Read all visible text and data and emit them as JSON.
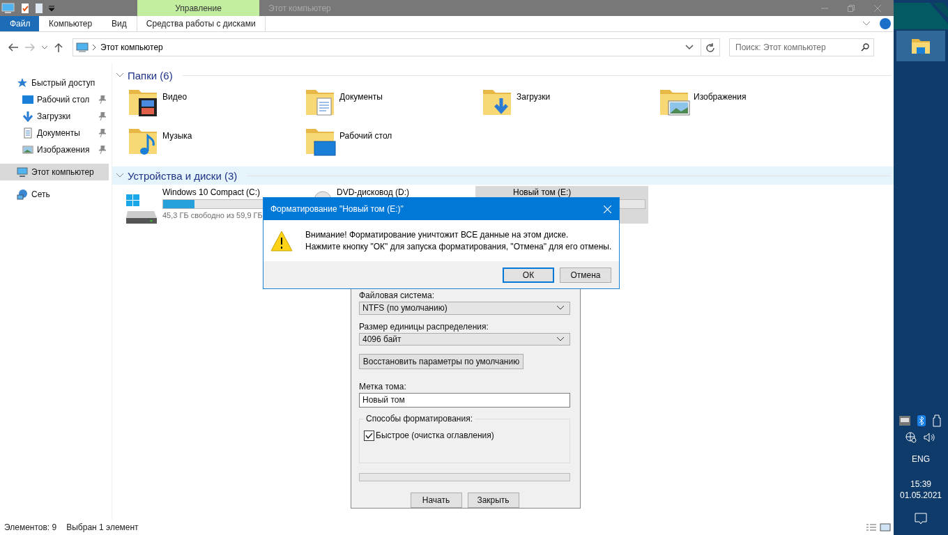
{
  "titlebar": {
    "context_tab": "Управление",
    "title": "Этот компьютер"
  },
  "ribbon_tabs": [
    {
      "label": "Файл",
      "kind": "file"
    },
    {
      "label": "Компьютер",
      "kind": "tab"
    },
    {
      "label": "Вид",
      "kind": "tab"
    },
    {
      "label": "Средства работы с дисками",
      "kind": "context"
    }
  ],
  "address": {
    "path": "Этот компьютер",
    "search_placeholder": "Поиск: Этот компьютер"
  },
  "nav": [
    {
      "label": "Быстрый доступ",
      "kind": "star",
      "selected": false,
      "children": [
        {
          "label": "Рабочий стол",
          "kind": "desktop",
          "pinned": true,
          "selected": false
        },
        {
          "label": "Загрузки",
          "kind": "downloads",
          "pinned": true,
          "selected": false
        },
        {
          "label": "Документы",
          "kind": "documents",
          "pinned": true,
          "selected": false
        },
        {
          "label": "Изображения",
          "kind": "pictures",
          "pinned": true,
          "selected": false
        }
      ]
    },
    {
      "label": "Этот компьютер",
      "kind": "pc",
      "selected": true
    },
    {
      "label": "Сеть",
      "kind": "network",
      "selected": false
    }
  ],
  "folders": {
    "title": "Папки (6)",
    "items": [
      {
        "label": "Видео",
        "kind": "video"
      },
      {
        "label": "Документы",
        "kind": "documents"
      },
      {
        "label": "Загрузки",
        "kind": "downloads"
      },
      {
        "label": "Изображения",
        "kind": "pictures"
      },
      {
        "label": "Музыка",
        "kind": "music"
      },
      {
        "label": "Рабочий стол",
        "kind": "desktop"
      }
    ]
  },
  "devices": {
    "title": "Устройства и диски (3)",
    "items": [
      {
        "kind": "system",
        "name": "Windows 10 Compact (C:)",
        "level": 0.24,
        "free": "45,3 ГБ свободно из 59,9 ГБ",
        "selected": false
      },
      {
        "kind": "dvd",
        "name": "DVD-дисковод (D:)",
        "selected": false
      },
      {
        "kind": "volume",
        "name": "Новый том (E:)",
        "level": 0,
        "selected": true
      }
    ]
  },
  "status_bar": {
    "count": "Элементов: 9",
    "selection": "Выбран 1 элемент"
  },
  "format_dialog": {
    "file_system_label": "Файловая система:",
    "file_system": "NTFS (по умолчанию)",
    "cluster_label": "Размер единицы распределения:",
    "cluster": "4096 байт",
    "restore_button": "Восстановить параметры по умолчанию",
    "volume_label_label": "Метка тома:",
    "volume_label": "Новый том",
    "methods_title": "Способы форматирования:",
    "quick_format": {
      "label": "Быстрое (очистка оглавления)",
      "checked": true
    },
    "progress": {
      "level": 0
    },
    "buttons": [
      "Начать",
      "Закрыть"
    ]
  },
  "confirm_dialog": {
    "title": "Форматирование \"Новый том (E:)\"",
    "lines": [
      "Внимание! Форматирование уничтожит ВСЕ данные на этом диске.",
      "Нажмите кнопку \"ОК\" для запуска форматирования, \"Отмена\" для его отмены."
    ],
    "buttons": [
      "ОК",
      "Отмена"
    ]
  },
  "taskbar": {
    "language": "ENG",
    "time": "15:39",
    "date": "01.05.2021"
  }
}
